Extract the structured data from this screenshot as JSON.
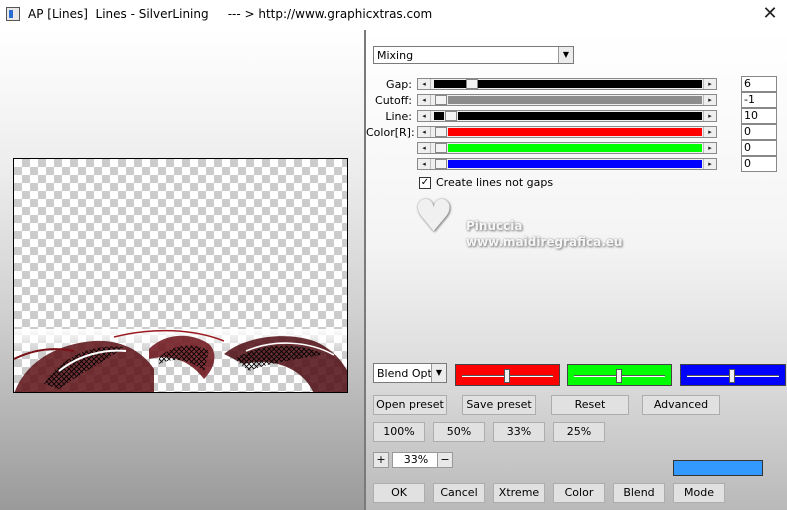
{
  "window": {
    "title": "AP [Lines]  Lines - SilverLining     --- > http://www.graphicxtras.com",
    "close_glyph": "✕"
  },
  "mode_dropdown": {
    "value": "Mixing"
  },
  "sliders": [
    {
      "label": "Gap:",
      "value": "6",
      "fill_color": "#000000"
    },
    {
      "label": "Cutoff:",
      "value": "-1",
      "fill_color": "#8c8c8c"
    },
    {
      "label": "Line:",
      "value": "10",
      "fill_color": "#000000"
    },
    {
      "label": "Color[R]:",
      "value": "0",
      "fill_color": "#ff0000"
    },
    {
      "label": "",
      "value": "0",
      "fill_color": "#00ff00"
    },
    {
      "label": "",
      "value": "0",
      "fill_color": "#0000ff"
    }
  ],
  "checkbox": {
    "label": "Create lines not gaps",
    "checked": true,
    "mark": "✓"
  },
  "watermark": {
    "name": "Pinuccia",
    "url": "www.maidiregrafica.eu",
    "icon": "heart-smiley-icon"
  },
  "blend": {
    "dropdown_value": "Blend Opti",
    "channel_colors": [
      "#ff0000",
      "#00ff00",
      "#0000ff"
    ]
  },
  "buttons": {
    "open_preset": "Open preset",
    "save_preset": "Save preset",
    "reset": "Reset",
    "advanced": "Advanced",
    "zoom_100": "100%",
    "zoom_50": "50%",
    "zoom_33": "33%",
    "zoom_25": "25%",
    "ok": "OK",
    "cancel": "Cancel",
    "xtreme": "Xtreme",
    "color": "Color",
    "blend": "Blend",
    "mode": "Mode"
  },
  "zoom": {
    "plus": "+",
    "minus": "−",
    "value": "33%"
  },
  "colors": {
    "swatch": "#3399ff",
    "divider": "#7a7a7a"
  },
  "icons": {
    "arrow_left": "◂",
    "arrow_right": "▸",
    "dropdown": "▼"
  }
}
